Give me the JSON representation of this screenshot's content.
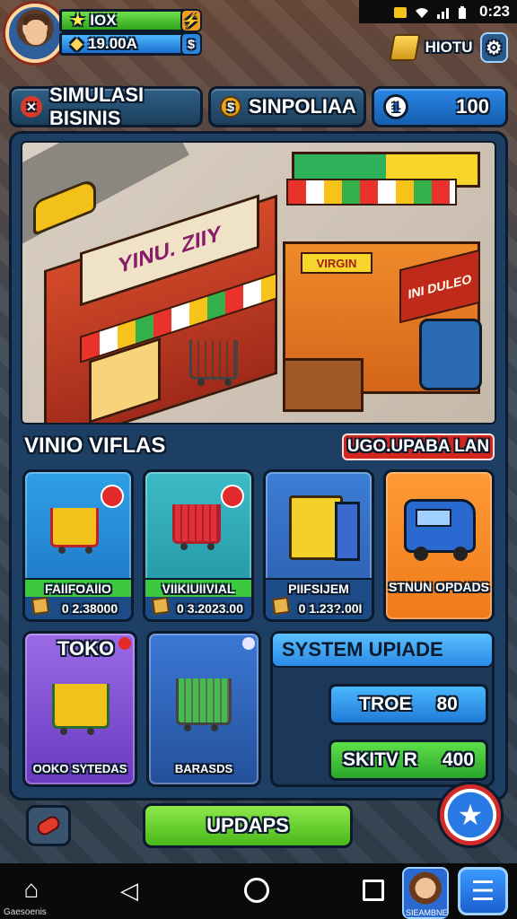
{
  "status_bar": {
    "time": "0:23"
  },
  "hud": {
    "level_value": "IOX",
    "money_value": "19.00A",
    "premium_value": "HIOTU"
  },
  "tabs": [
    {
      "label": "SIMULASI BISINIS",
      "icon": "wrench-icon"
    },
    {
      "label": "SINPOLIAA",
      "icon": "coin-icon"
    },
    {
      "label": "100",
      "icon": "gem-icon"
    }
  ],
  "scene": {
    "shop1_sign": "YINU. ZIIY",
    "shop2_sign": "VIRGIN",
    "shop2_sign2": "INI DULEO"
  },
  "section": {
    "title": "VINIO VIFLAS",
    "badge": "UGO.UPABA LAN"
  },
  "cards": [
    {
      "name": "FAIIFOAIIO",
      "value": "0 2.38000",
      "icon": "cart-icon"
    },
    {
      "name": "VIIKIUIIVIAL",
      "value": "0 3.2023.00",
      "icon": "shopping-cart-icon"
    },
    {
      "name": "PIIFSIJEM",
      "value": "0 1.23?.00I",
      "icon": "bin-icon"
    },
    {
      "name": "STNUN OPDADS",
      "value": "",
      "icon": "van-icon"
    }
  ],
  "cards2": [
    {
      "title": "TOKO",
      "footer": "OOKO SYTEDAS",
      "icon": "cart-icon"
    },
    {
      "title": "",
      "footer": "BARASDS",
      "icon": "shopping-cart-icon"
    }
  ],
  "system": {
    "title": "SYSTEM UPIADE",
    "btn1_label": "TROE",
    "btn1_value": "80",
    "btn2_label": "SKITV R",
    "btn2_value": "400"
  },
  "actions": {
    "update_label": "UPDAPS"
  },
  "navbar": {
    "home_label": "Gaesoenis",
    "avatar_label": "SIEAMBNE"
  },
  "colors": {
    "panel": "#1d3f64",
    "accent_green": "#4ab81a",
    "accent_blue": "#2a8ae6",
    "badge_red": "#d2261e"
  }
}
